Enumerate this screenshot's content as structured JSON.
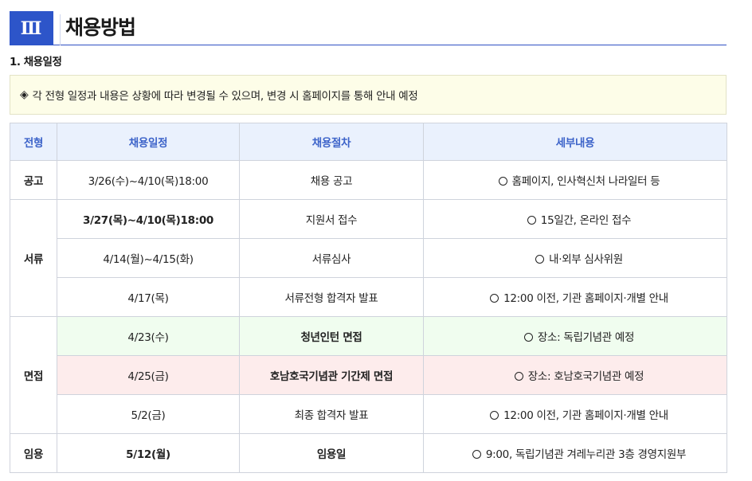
{
  "header": {
    "section_number": "Ⅲ",
    "title": "채용방법"
  },
  "subsection": {
    "title": "1. 채용일정"
  },
  "notice": {
    "icon": "diamond-icon",
    "text": "각 전형 일정과 내용은 상황에 따라 변경될 수 있으며, 변경 시 홈페이지를 통해 안내 예정"
  },
  "table": {
    "headers": [
      "전형",
      "채용일정",
      "채용절차",
      "세부내용"
    ],
    "stages": {
      "announce": "공고",
      "document": "서류",
      "interview": "면접",
      "appoint": "임용"
    },
    "rows": [
      {
        "date": "3/26(수)~4/10(목)18:00",
        "procedure": "채용 공고",
        "detail": "홈페이지, 인사혁신처 나라일터 등"
      },
      {
        "date": "3/27(목)~4/10(목)18:00",
        "procedure": "지원서 접수",
        "detail": "15일간, 온라인 접수"
      },
      {
        "date": "4/14(월)~4/15(화)",
        "procedure": "서류심사",
        "detail": "내·외부 심사위원"
      },
      {
        "date": "4/17(목)",
        "procedure": "서류전형 합격자 발표",
        "detail": "12:00 이전, 기관 홈페이지·개별 안내"
      },
      {
        "date": "4/23(수)",
        "procedure": "청년인턴 면접",
        "detail": "장소: 독립기념관 예정"
      },
      {
        "date": "4/25(금)",
        "procedure": "호남호국기념관 기간제 면접",
        "detail": "장소: 호남호국기념관 예정"
      },
      {
        "date": "5/2(금)",
        "procedure": "최종 합격자 발표",
        "detail": "12:00 이전, 기관 홈페이지·개별 안내"
      },
      {
        "date": "5/12(월)",
        "procedure": "임용일",
        "detail": "9:00, 독립기념관 겨레누리관 3층 경영지원부"
      }
    ],
    "highlight_colors": {
      "header_bg": "#eaf1fd",
      "header_text": "#3c63c9",
      "green_row": "#f0fdef",
      "pink_row": "#fdecec"
    }
  },
  "colors": {
    "accent": "#2d55c9"
  }
}
